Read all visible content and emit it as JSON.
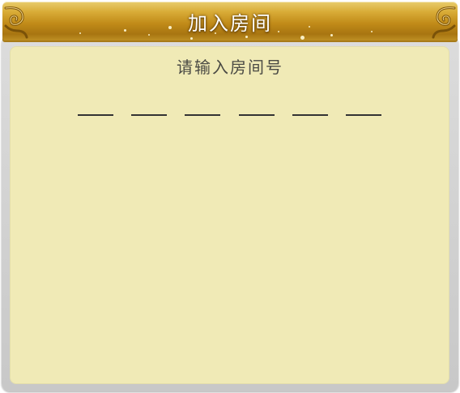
{
  "dialog": {
    "title": "加入房间",
    "prompt": "请输入房间号",
    "room_number_digits": [
      "",
      "",
      "",
      "",
      "",
      ""
    ]
  },
  "colors": {
    "title_bar": "#c08a18",
    "panel_background": "#f0eab6",
    "frame": "#d2d2d2",
    "text": "#4a4a44"
  },
  "icons": {
    "corner_left": "cloud-swirl-icon",
    "corner_right": "cloud-swirl-icon"
  }
}
